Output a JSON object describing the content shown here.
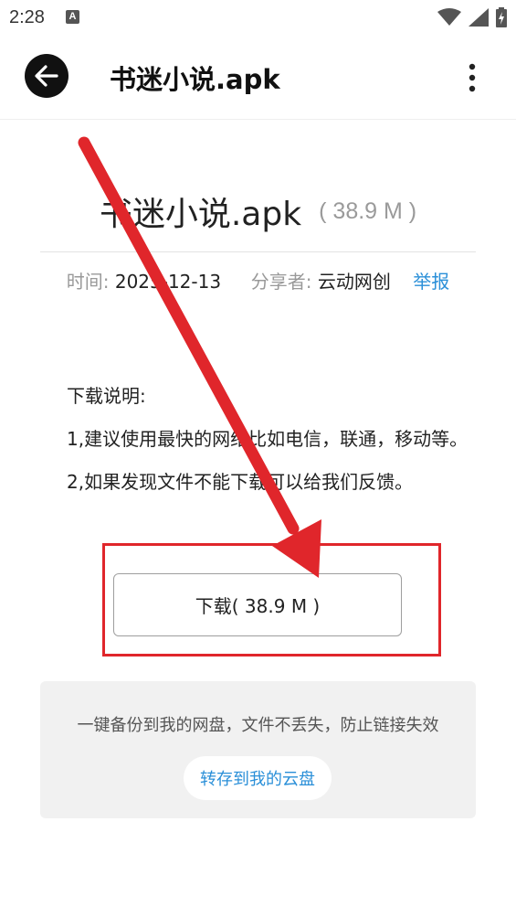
{
  "status": {
    "time": "2:28",
    "notification_letter": "A"
  },
  "app_bar": {
    "title": "书迷小说.apk"
  },
  "file": {
    "name": "书迷小说.apk",
    "size": "( 38.9 M )",
    "time_label": "时间:",
    "time_value": "2025-12-13",
    "sharer_label": "分享者:",
    "sharer_value": "云动网创",
    "report_label": "举报"
  },
  "instructions": {
    "heading": "下载说明:",
    "line1": "1,建议使用最快的网络比如电信，联通，移动等。",
    "line2": "2,如果发现文件不能下载可以给我们反馈。"
  },
  "download": {
    "label": "下载( 38.9 M )"
  },
  "backup": {
    "description": "一键备份到我的网盘，文件不丢失，防止链接失效",
    "save_label": "转存到我的云盘"
  },
  "colors": {
    "accent": "#2a8fd8",
    "annotation": "#e0262b"
  }
}
